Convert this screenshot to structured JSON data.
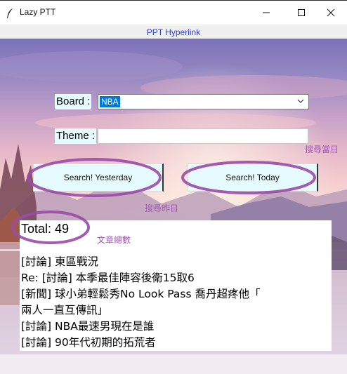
{
  "window": {
    "title": "Lazy PTT"
  },
  "header": {
    "hyperlink_text": "PPT Hyperlink"
  },
  "form": {
    "board_label": "Board :",
    "board_value": "NBA",
    "theme_label": "Theme :",
    "theme_value": ""
  },
  "buttons": {
    "yesterday_label": "Search! Yesterday",
    "today_label": "Search! Today"
  },
  "annotations": {
    "search_today": "搜尋當日",
    "search_yesterday": "搜尋昨日",
    "article_count": "文章總數"
  },
  "results": {
    "total_text": "Total: 49",
    "articles": [
      "[討論] 東區戰況",
      "Re: [討論] 本季最佳陣容後衛15取6",
      "[新聞] 球小弟輕鬆秀No Look Pass 喬丹超疼他「",
      "兩人一直互傳訊」",
      "[討論] NBA最速男現在是誰",
      "[討論] 90年代初期的拓荒者"
    ]
  },
  "colors": {
    "annotation_purple": "#a357b8",
    "ring_purple": "#9a4aa8",
    "link_blue": "#2f3fd6",
    "widget_bg": "#e6fbff",
    "selection_blue": "#0078d7"
  },
  "icons": [
    "feather-icon",
    "minimize-icon",
    "maximize-icon",
    "close-icon",
    "chevron-down-icon"
  ]
}
